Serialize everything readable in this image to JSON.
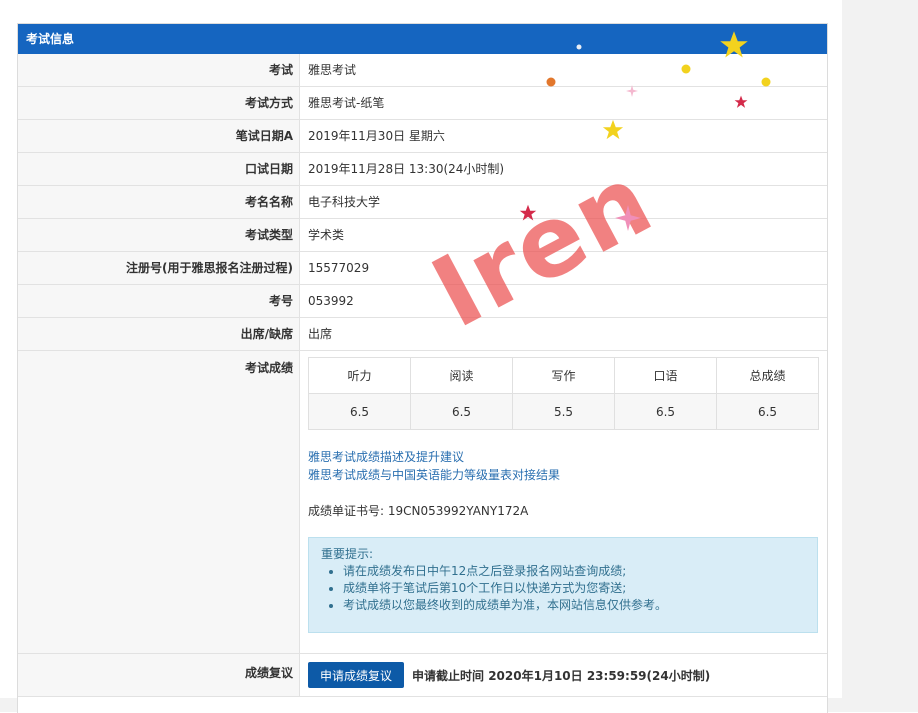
{
  "panel": {
    "title": "考试信息"
  },
  "rows": [
    {
      "label": "考试",
      "value": "雅思考试"
    },
    {
      "label": "考试方式",
      "value": "雅思考试-纸笔"
    },
    {
      "label": "笔试日期A",
      "value": "2019年11月30日 星期六"
    },
    {
      "label": "口试日期",
      "value": "2019年11月28日 13:30(24小时制)"
    },
    {
      "label": "考名名称",
      "value": "电子科技大学"
    },
    {
      "label": "考试类型",
      "value": "学术类"
    },
    {
      "label": "注册号(用于雅思报名注册过程)",
      "value": "15577029"
    },
    {
      "label": "考号",
      "value": "053992"
    },
    {
      "label": "出席/缺席",
      "value": "出席"
    }
  ],
  "scores": {
    "label": "考试成绩",
    "headers": [
      "听力",
      "阅读",
      "写作",
      "口语",
      "总成绩"
    ],
    "values": [
      "6.5",
      "6.5",
      "5.5",
      "6.5",
      "6.5"
    ],
    "link1": "雅思考试成绩描述及提升建议",
    "link2": "雅思考试成绩与中国英语能力等级量表对接结果",
    "cert": "成绩单证书号: 19CN053992YANY172A"
  },
  "notice": {
    "title": "重要提示:",
    "items": [
      "请在成绩发布日中午12点之后登录报名网站查询成绩;",
      "成绩单将于笔试后第10个工作日以快递方式为您寄送;",
      "考试成绩以您最终收到的成绩单为准，本网站信息仅供参考。"
    ]
  },
  "review": {
    "label": "成绩复议",
    "button": "申请成绩复议",
    "deadline": "申请截止时间 2020年1月10日 23:59:59(24小时制)"
  },
  "watermark": {
    "text": "Iren",
    "color": "#eb5050"
  },
  "colors": {
    "header": "#1565c0",
    "link": "#2a6fb0",
    "button": "#0d5aa7",
    "notice_bg": "#d9edf7"
  },
  "icons": [
    "star-icon",
    "sparkle-icon",
    "dot-icon"
  ]
}
